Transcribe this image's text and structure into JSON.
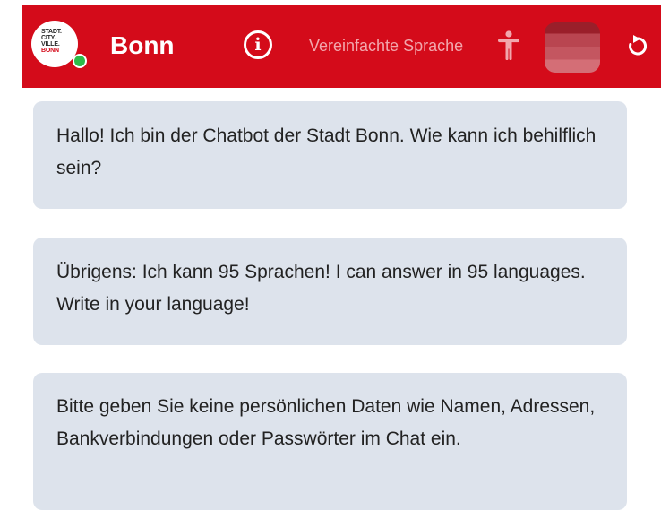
{
  "header": {
    "logo_lines": [
      "STADT.",
      "CITY.",
      "VILLE.",
      "BONN"
    ],
    "title": "Bonn",
    "info_icon": "info-icon",
    "info_glyph": "i",
    "simple_language_label": "Vereinfachte Sprache",
    "accessibility_icon": "accessibility-person-icon",
    "refresh_icon": "refresh-icon",
    "online_status_color": "#2dbb48"
  },
  "colors": {
    "brand": "#d40b1a",
    "bubble": "#dde3ec",
    "text": "#222222"
  },
  "messages": [
    {
      "text": "Hallo! Ich bin der Chatbot der Stadt Bonn. Wie kann ich behilflich sein?"
    },
    {
      "text": "Übrigens: Ich kann 95 Sprachen! I can answer in 95 languages. Write in your language!"
    },
    {
      "text": "Bitte geben Sie keine persönlichen Daten wie Namen, Adressen, Bankverbindungen oder Passwörter im Chat ein."
    }
  ]
}
